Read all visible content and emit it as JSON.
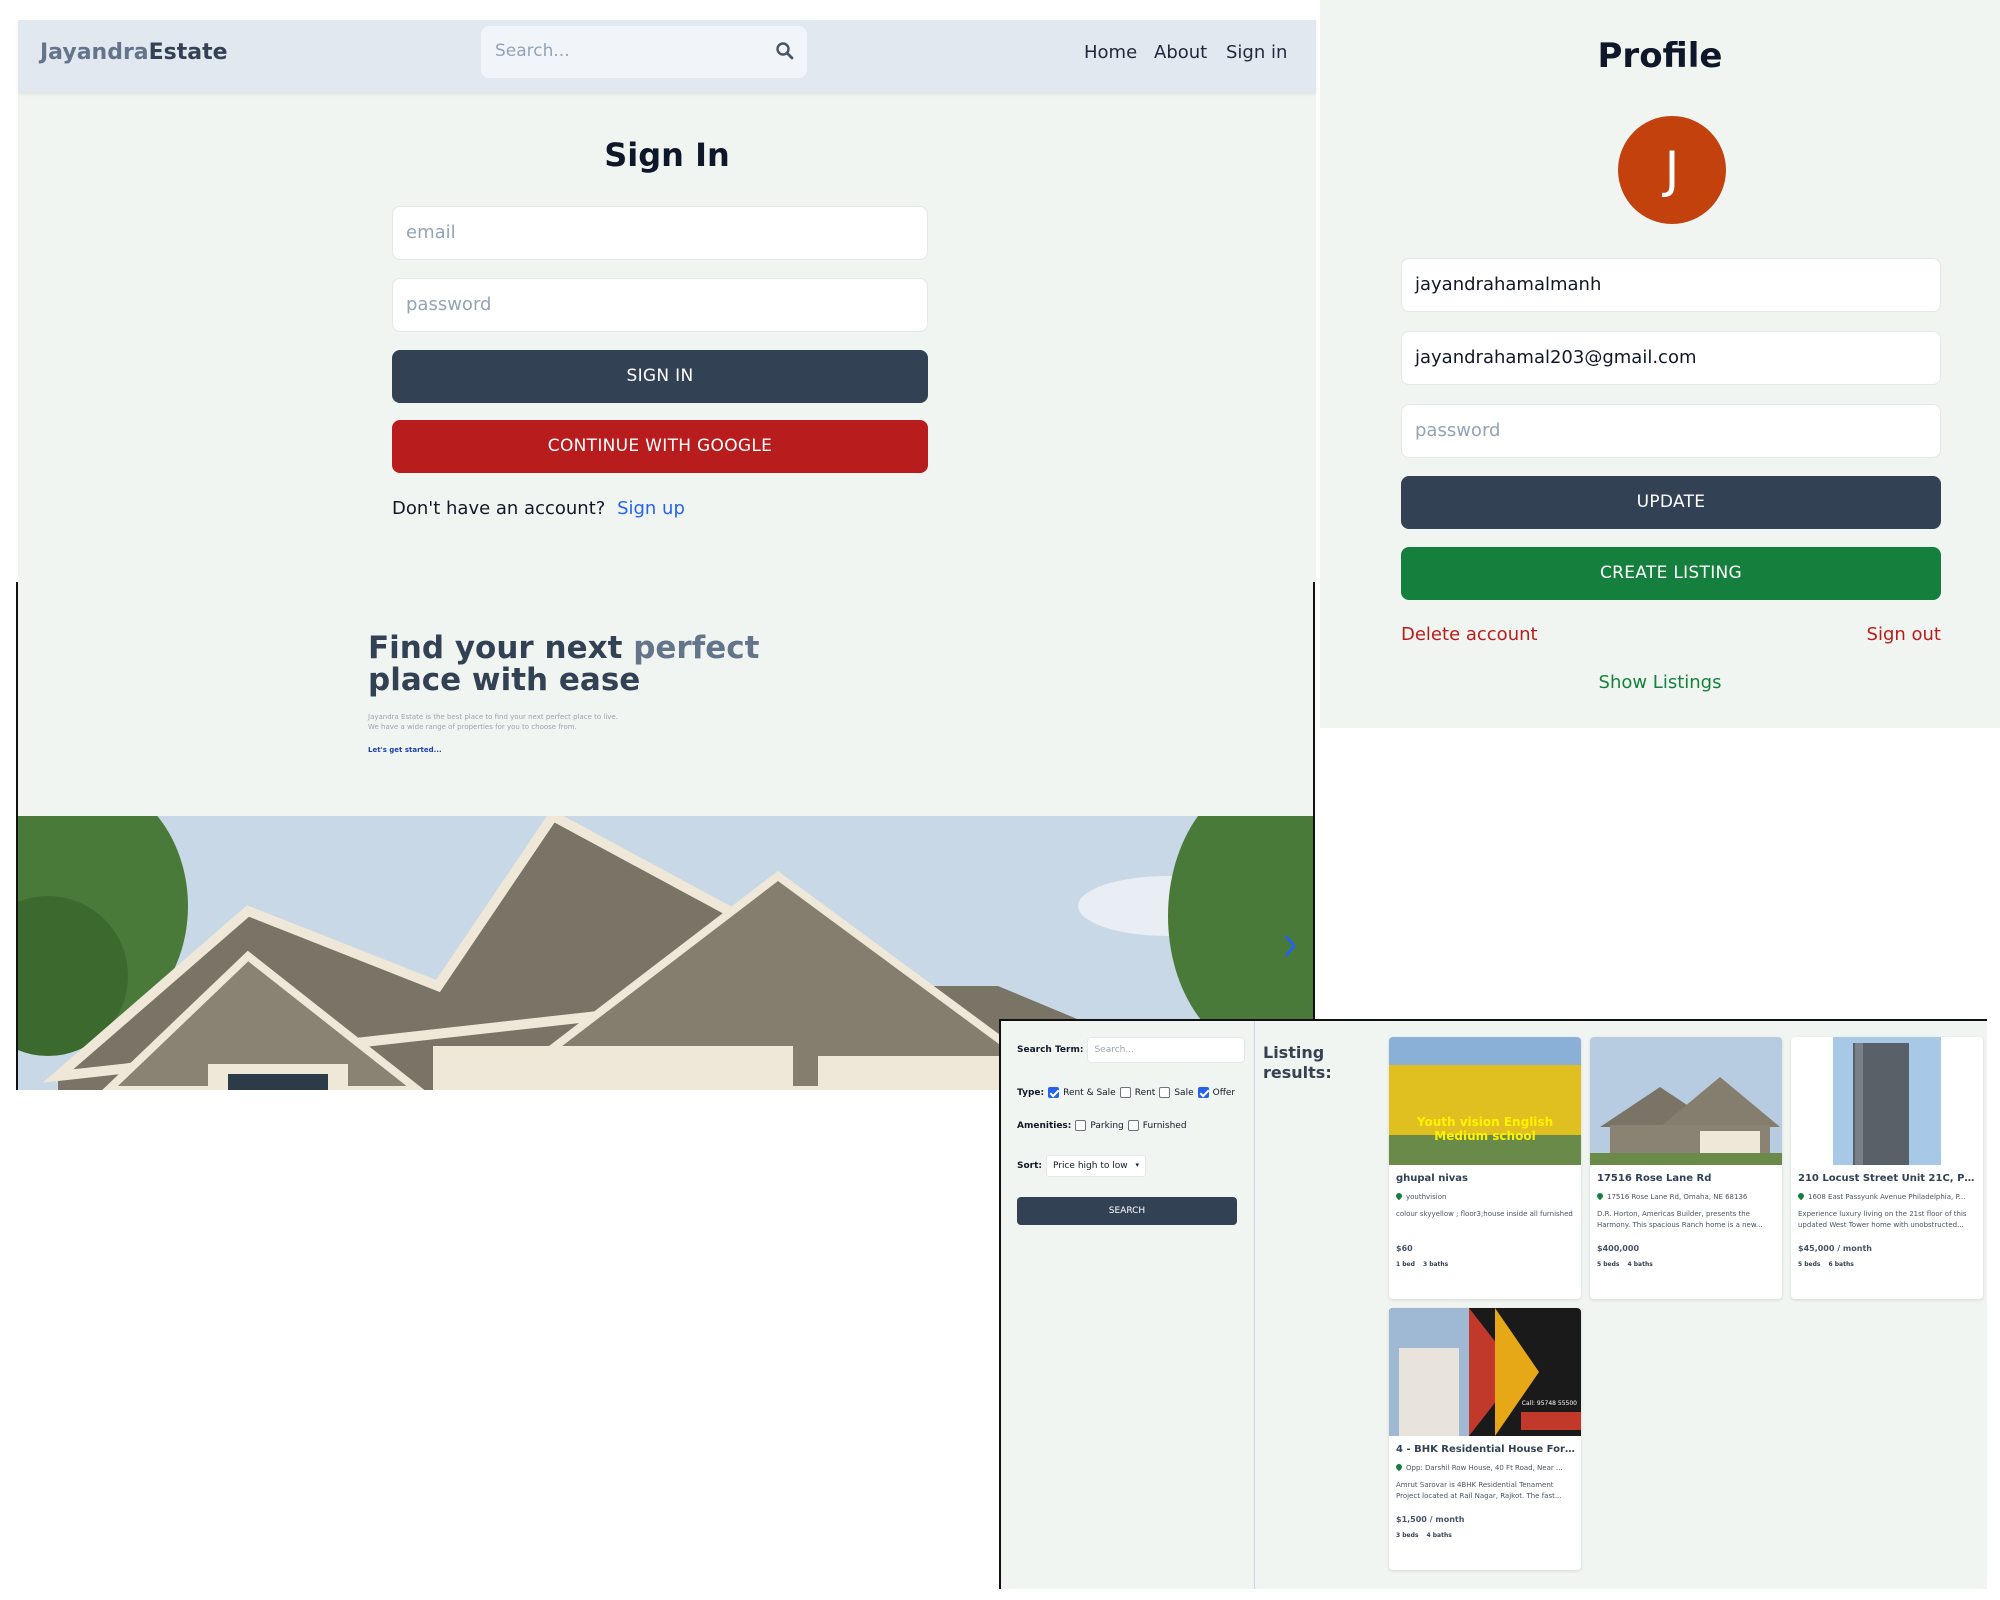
{
  "signin_page": {
    "header": {
      "logo_part1": "Jayandra",
      "logo_part2": "Estate",
      "search_placeholder": "Search...",
      "nav": [
        "Home",
        "About",
        "Sign in"
      ]
    },
    "title": "Sign In",
    "email_placeholder": "email",
    "password_placeholder": "password",
    "signin_button": "SIGN IN",
    "google_button": "CONTINUE WITH GOOGLE",
    "no_account_text": "Don't have an account?",
    "signup_link": "Sign up",
    "colors": {
      "primary": "#334155",
      "google": "#b91c1c",
      "link": "#2563eb"
    }
  },
  "profile_page": {
    "title": "Profile",
    "avatar_initial": "J",
    "username_value": "jayandrahamalmanh",
    "email_value": "jayandrahamal203@gmail.com",
    "password_placeholder": "password",
    "update_button": "UPDATE",
    "create_listing_button": "CREATE LISTING",
    "delete_account": "Delete account",
    "sign_out": "Sign out",
    "show_listings": "Show Listings",
    "colors": {
      "avatar": "#c2410c",
      "create": "#15803d",
      "danger": "#b91c1c"
    }
  },
  "hero": {
    "title_part1": "Find your next ",
    "title_accent": "perfect",
    "title_part2": "place with ease",
    "subtitle_line1": "Jayandra Estate is the best place to find your next perfect place to live.",
    "subtitle_line2": "We have a wide range of properties for you to choose from.",
    "cta": "Let's get started..."
  },
  "search_page": {
    "search_term_label": "Search Term:",
    "search_placeholder": "Search...",
    "type_label": "Type:",
    "types": [
      {
        "label": "Rent & Sale",
        "checked": true
      },
      {
        "label": "Rent",
        "checked": false
      },
      {
        "label": "Sale",
        "checked": false
      },
      {
        "label": "Offer",
        "checked": true
      }
    ],
    "amenities_label": "Amenities:",
    "amenities": [
      {
        "label": "Parking",
        "checked": false
      },
      {
        "label": "Furnished",
        "checked": false
      }
    ],
    "sort_label": "Sort:",
    "sort_value": "Price high to low",
    "search_button": "SEARCH",
    "results_title_line1": "Listing",
    "results_title_line2": "results:",
    "listings": [
      {
        "name": "ghupal nivas",
        "address": "youthvision",
        "description": "colour skyyellow ; floor3;house inside all furnished",
        "price": "$60",
        "beds": "1 bed",
        "baths": "3 baths",
        "image_text": "Youth vision English Medium school"
      },
      {
        "name": "17516 Rose Lane Rd",
        "address": "17516 Rose Lane Rd, Omaha, NE 68136",
        "description": "D.R. Horton, Americas Builder, presents the Harmony. This spacious Ranch home is a new...",
        "price": "$400,000",
        "beds": "5 beds",
        "baths": "4 baths",
        "image_text": ""
      },
      {
        "name": "210 Locust Street Unit 21C, Phila...",
        "address": "1608 East Passyunk Avenue Philadelphia, P...",
        "description": "Experience luxury living on the 21st floor of this updated West Tower home with unobstructed...",
        "price": "$45,000 / month",
        "beds": "5 beds",
        "baths": "6 baths",
        "image_text": ""
      },
      {
        "name": "4 - BHK Residential House For Sal...",
        "address": "Opp: Darshil Row House, 40 Ft Road, Near ...",
        "description": "Amrut Sarovar is 4BHK Residential Tenament Project located at Rail Nagar, Rajkot. The fast...",
        "price": "$1,500 / month",
        "beds": "3 beds",
        "baths": "4 baths",
        "image_text": "Call: 95748 55500"
      }
    ]
  }
}
